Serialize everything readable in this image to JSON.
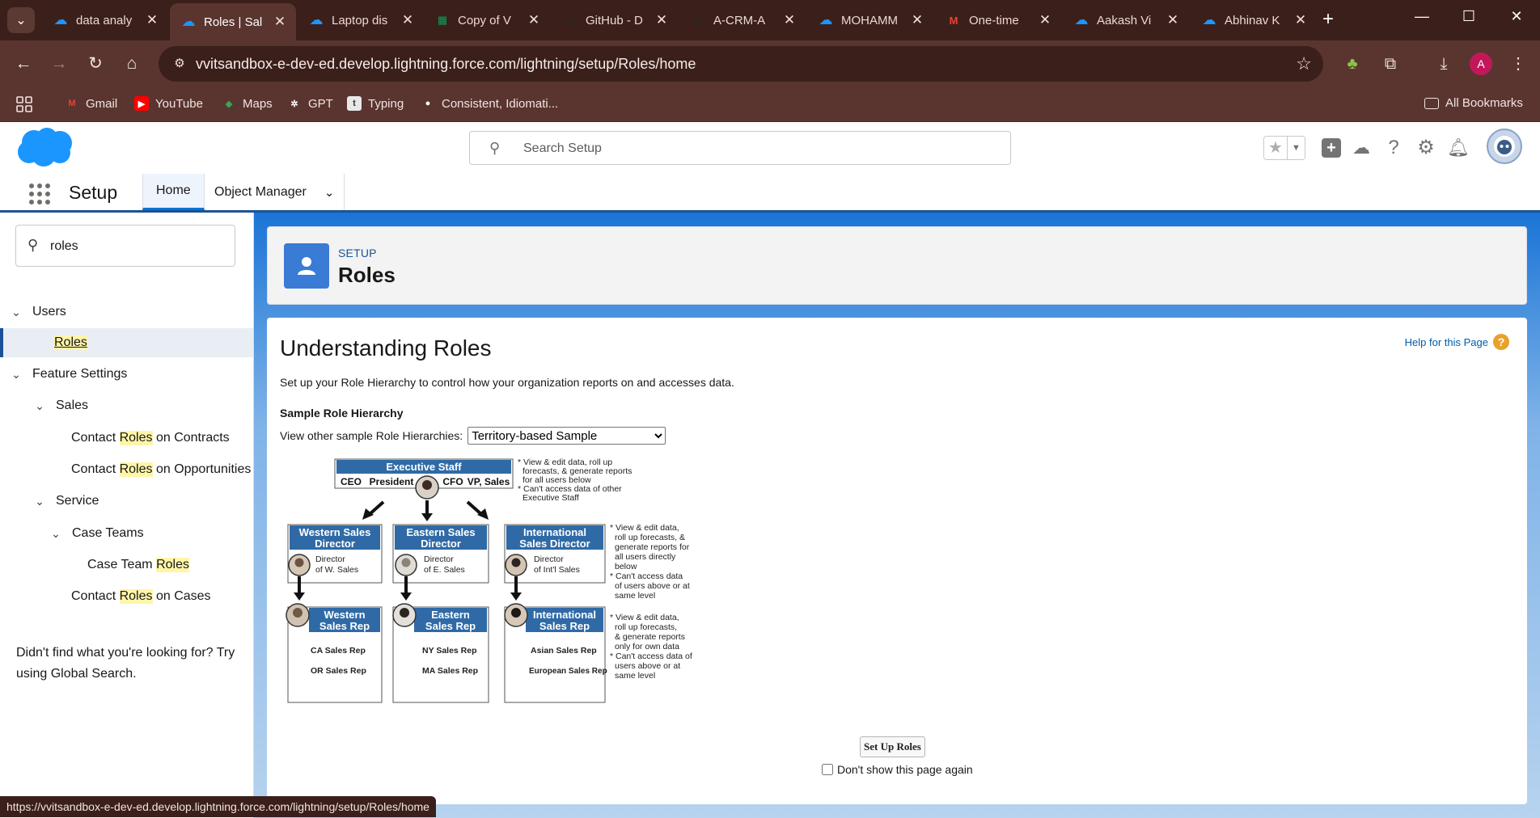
{
  "browser": {
    "tabs": [
      {
        "title": "data analy",
        "favicon": "salesforce-cloud"
      },
      {
        "title": "Roles | Sal",
        "favicon": "salesforce-cloud",
        "active": true
      },
      {
        "title": "Laptop dis",
        "favicon": "salesforce-cloud"
      },
      {
        "title": "Copy of V",
        "favicon": "google-sheets"
      },
      {
        "title": "GitHub - D",
        "favicon": "github"
      },
      {
        "title": "A-CRM-A",
        "favicon": "github"
      },
      {
        "title": "MOHAMM",
        "favicon": "salesforce-cloud"
      },
      {
        "title": "One-time",
        "favicon": "gmail"
      },
      {
        "title": "Aakash Vi",
        "favicon": "salesforce-cloud"
      },
      {
        "title": "Abhinav K",
        "favicon": "salesforce-cloud"
      }
    ],
    "url": "vvitsandbox-e-dev-ed.develop.lightning.force.com/lightning/setup/Roles/home",
    "profile_initial": "A",
    "bookmarks": [
      {
        "label": "Gmail",
        "icon": "gmail-icon"
      },
      {
        "label": "YouTube",
        "icon": "youtube-icon"
      },
      {
        "label": "Maps",
        "icon": "maps-icon"
      },
      {
        "label": "GPT",
        "icon": "openai-icon"
      },
      {
        "label": "Typing",
        "icon": "typing-icon"
      },
      {
        "label": "Consistent, Idiomati...",
        "icon": "github-icon"
      }
    ],
    "all_bookmarks": "All Bookmarks",
    "status_url": "https://vvitsandbox-e-dev-ed.develop.lightning.force.com/lightning/setup/Roles/home"
  },
  "header": {
    "search_placeholder": "Search Setup"
  },
  "nav": {
    "app_name": "Setup",
    "tabs": [
      {
        "label": "Home"
      },
      {
        "label": "Object Manager"
      }
    ]
  },
  "sidebar": {
    "quick_find_value": "roles",
    "items": [
      {
        "label": "Users"
      },
      {
        "label": "Roles"
      },
      {
        "label": "Feature Settings"
      },
      {
        "label": "Sales"
      },
      {
        "pre": "Contact ",
        "hl": "Roles",
        "post": " on Contracts"
      },
      {
        "pre": "Contact ",
        "hl": "Roles",
        "post": " on Opportunities"
      },
      {
        "label": "Service"
      },
      {
        "label": "Case Teams"
      },
      {
        "pre": "Case Team ",
        "hl": "Roles",
        "post": ""
      },
      {
        "pre": "Contact ",
        "hl": "Roles",
        "post": " on Cases"
      }
    ],
    "not_found": "Didn't find what you're looking for? Try using Global Search."
  },
  "page_header": {
    "eyebrow": "SETUP",
    "title": "Roles"
  },
  "content": {
    "title": "Understanding Roles",
    "help_link": "Help for this Page",
    "description": "Set up your Role Hierarchy to control how your organization reports on and accesses data.",
    "sample_heading": "Sample Role Hierarchy",
    "view_label": "View other sample Role Hierarchies:",
    "select_value": "Territory-based Sample",
    "setup_button": "Set Up Roles",
    "dont_show": "Don't show this page again"
  },
  "diagram": {
    "exec": {
      "title": "Executive Staff",
      "roles": [
        "CEO",
        "President",
        "CFO",
        "VP, Sales"
      ],
      "notes": [
        "* View & edit data, roll up",
        "forecasts, & generate reports",
        "for all users below",
        "* Can't access data of other",
        "Executive Staff"
      ]
    },
    "directors": [
      {
        "title1": "Western Sales",
        "title2": "Director",
        "sub1": "Director",
        "sub2": "of W. Sales"
      },
      {
        "title1": "Eastern Sales",
        "title2": "Director",
        "sub1": "Director",
        "sub2": "of E. Sales"
      },
      {
        "title1": "International",
        "title2": "Sales Director",
        "sub1": "Director",
        "sub2": "of Int'l Sales"
      }
    ],
    "director_notes": [
      "* View & edit data,",
      "roll up forecasts, &",
      "generate reports for",
      "all users directly",
      "below",
      "* Can't access data",
      "of users above or at",
      "same level"
    ],
    "reps": [
      {
        "title1": "Western",
        "title2": "Sales Rep",
        "items": [
          "CA Sales Rep",
          "OR Sales Rep"
        ]
      },
      {
        "title1": "Eastern",
        "title2": "Sales Rep",
        "items": [
          "NY Sales Rep",
          "MA Sales Rep"
        ]
      },
      {
        "title1": "International",
        "title2": "Sales Rep",
        "items": [
          "Asian Sales Rep",
          "European Sales Rep"
        ]
      }
    ],
    "rep_notes": [
      "* View & edit data,",
      "roll up forecasts,",
      "& generate reports",
      "only for own data",
      "* Can't access data of",
      "users above or at",
      "same level"
    ]
  },
  "colors": {
    "chrome_dark": "#3b1f1a",
    "chrome_mid": "#5a3530",
    "sf_blue": "#1b5297",
    "sf_brand": "#0176d3",
    "highlight": "#fff5a8",
    "diagram_blue": "#2f6aa6"
  }
}
